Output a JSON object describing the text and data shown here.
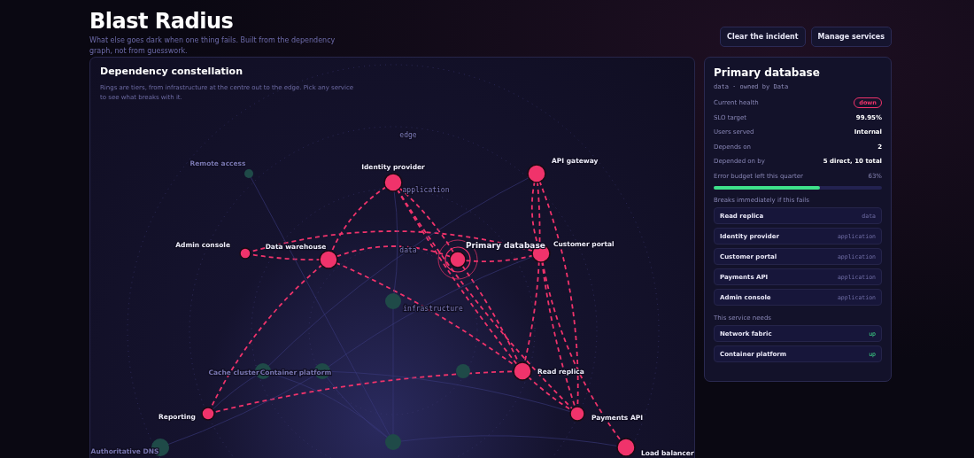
{
  "header": {
    "title": "Blast Radius",
    "subtitle": "What else goes dark when one thing fails. Built from the dependency graph, not from guesswork."
  },
  "actions": [
    "Clear the incident",
    "Manage services"
  ],
  "constellation": {
    "title": "Dependency constellation",
    "description": "Rings are tiers, from infrastructure at the centre out to the edge. Pick any service to see what breaks with it.",
    "tiers": [
      "edge",
      "application",
      "data",
      "infrastructure"
    ],
    "nodes": [
      {
        "label": "Identity provider",
        "affected": true,
        "selected": false
      },
      {
        "label": "API gateway",
        "affected": true,
        "selected": false
      },
      {
        "label": "Admin console",
        "affected": true,
        "selected": false
      },
      {
        "label": "Data warehouse",
        "affected": true,
        "selected": false
      },
      {
        "label": "Primary database",
        "affected": true,
        "selected": true
      },
      {
        "label": "Customer portal",
        "affected": true,
        "selected": false
      },
      {
        "label": "Read replica",
        "affected": true,
        "selected": false
      },
      {
        "label": "Reporting",
        "affected": true,
        "selected": false
      },
      {
        "label": "Payments API",
        "affected": true,
        "selected": false
      },
      {
        "label": "Load balancer",
        "affected": true,
        "selected": false
      },
      {
        "label": "Remote access",
        "affected": false,
        "selected": false
      },
      {
        "affected": false,
        "selected": false
      },
      {
        "label": "Cache cluster",
        "affected": false,
        "selected": false
      },
      {
        "label": "Container platform",
        "affected": false,
        "selected": false
      },
      {
        "affected": false,
        "selected": false
      },
      {
        "label": "Authoritative DNS",
        "affected": false,
        "selected": false
      },
      {
        "affected": false,
        "selected": false
      }
    ]
  },
  "detail": {
    "title": "Primary database",
    "meta": "data · owned by Data",
    "facts": [
      {
        "label": "Current health",
        "value": "down",
        "kind": "badge"
      },
      {
        "label": "SLO target",
        "value": "99.95%",
        "kind": "text"
      },
      {
        "label": "Users served",
        "value": "Internal",
        "kind": "text"
      },
      {
        "label": "Depends on",
        "value": "2",
        "kind": "text"
      },
      {
        "label": "Depended on by",
        "value": "5 direct, 10 total",
        "kind": "text"
      }
    ],
    "budget": {
      "label": "Error budget left this quarter",
      "reading": "63%",
      "level": 0.63
    },
    "breaks_title": "Breaks immediately if this fails",
    "breaks": [
      {
        "name": "Read replica",
        "tier": "data"
      },
      {
        "name": "Identity provider",
        "tier": "application"
      },
      {
        "name": "Customer portal",
        "tier": "application"
      },
      {
        "name": "Payments API",
        "tier": "application"
      },
      {
        "name": "Admin console",
        "tier": "application"
      }
    ],
    "needs_title": "This service needs",
    "needs": [
      {
        "name": "Network fabric",
        "status": "up"
      },
      {
        "name": "Container platform",
        "status": "up"
      }
    ]
  }
}
